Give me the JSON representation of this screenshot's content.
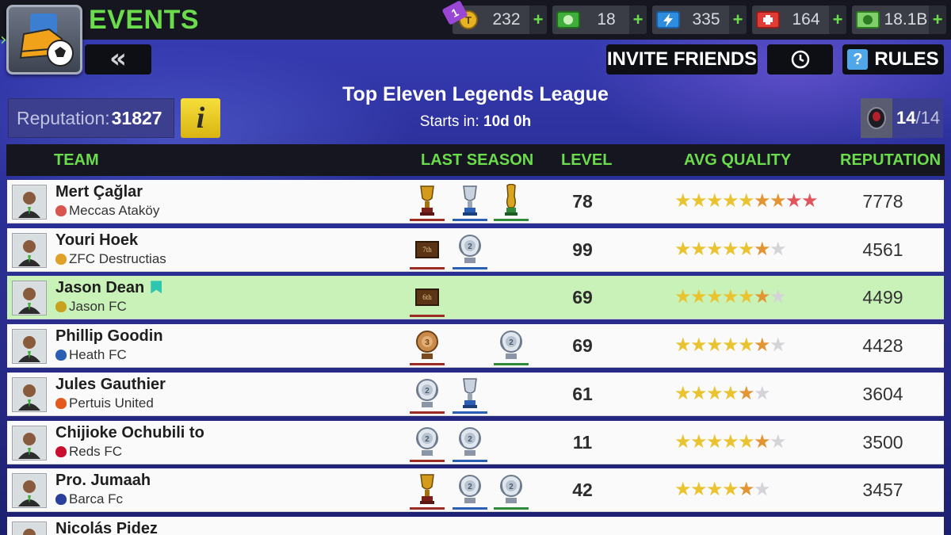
{
  "header": {
    "title": "EVENTS",
    "back_label": "«",
    "invite_label": "INVITE FRIENDS",
    "rules_label": "RULES",
    "rules_icon_glyph": "?"
  },
  "currencies": [
    {
      "icon": "token-coin-icon",
      "value": "232",
      "badge": "1"
    },
    {
      "icon": "cash-money-icon",
      "value": "18"
    },
    {
      "icon": "lightning-boost-icon",
      "value": "335"
    },
    {
      "icon": "health-cross-icon",
      "value": "164"
    },
    {
      "icon": "banknote-icon",
      "value": "18.1B"
    }
  ],
  "currency_plus": "+",
  "league": {
    "title": "Top Eleven Legends League",
    "starts_label": "Starts in:",
    "starts_value": "10d 0h",
    "reputation_label": "Reputation:",
    "reputation_value": "31827",
    "info_glyph": "i",
    "participants_current": "14",
    "participants_total": "/14"
  },
  "table": {
    "columns": [
      "TEAM",
      "LAST SEASON",
      "LEVEL",
      "AVG QUALITY",
      "REPUTATION"
    ],
    "rows": [
      {
        "manager": "Mert Çağlar",
        "team": "Meccas Ataköy",
        "level": "78",
        "reputation": "7778",
        "stars_gold": 5,
        "stars_orange": 2,
        "stars_red": 2,
        "stars_empty": 0,
        "is_me": false,
        "trophies": [
          "gold-cup",
          "silver-cup",
          "world-cup"
        ]
      },
      {
        "manager": "Youri Hoek",
        "team": "ZFC Destructias",
        "level": "99",
        "reputation": "4561",
        "stars_gold": 5,
        "stars_orange": 1,
        "stars_red": 0,
        "stars_empty": 1,
        "is_me": false,
        "trophies": [
          "placard-7th",
          "silver-medal-2"
        ],
        "placard": "7th"
      },
      {
        "manager": "Jason Dean",
        "team": "Jason FC",
        "level": "69",
        "reputation": "4499",
        "stars_gold": 5,
        "stars_orange": 1,
        "stars_red": 0,
        "stars_empty": 1,
        "is_me": true,
        "trophies": [
          "placard-6th"
        ],
        "placard": "6th"
      },
      {
        "manager": "Phillip Goodin",
        "team": "Heath FC",
        "level": "69",
        "reputation": "4428",
        "stars_gold": 5,
        "stars_orange": 1,
        "stars_red": 0,
        "stars_empty": 1,
        "is_me": false,
        "trophies": [
          "bronze-medal-3",
          "silver-medal-2"
        ]
      },
      {
        "manager": "Jules Gauthier",
        "team": "Pertuis United",
        "level": "61",
        "reputation": "3604",
        "stars_gold": 4,
        "stars_orange": 1,
        "stars_red": 0,
        "stars_empty": 1,
        "is_me": false,
        "trophies": [
          "silver-medal-2",
          "silver-cup"
        ]
      },
      {
        "manager": "Chijioke Ochubili to",
        "team": "Reds FC",
        "level": "11",
        "reputation": "3500",
        "stars_gold": 5,
        "stars_orange": 1,
        "stars_red": 0,
        "stars_empty": 1,
        "is_me": false,
        "trophies": [
          "silver-medal-2",
          "silver-medal-2"
        ]
      },
      {
        "manager": "Pro. Jumaah",
        "team": "Barca Fc",
        "level": "42",
        "reputation": "3457",
        "stars_gold": 4,
        "stars_orange": 1,
        "stars_red": 0,
        "stars_empty": 1,
        "is_me": false,
        "trophies": [
          "gold-cup",
          "silver-medal-2",
          "silver-medal-2"
        ]
      },
      {
        "manager": "Nicolás Pidez",
        "team": "",
        "level": "",
        "reputation": "",
        "stars_gold": 0,
        "stars_orange": 0,
        "stars_red": 0,
        "stars_empty": 0,
        "is_me": false,
        "trophies": []
      }
    ]
  },
  "colors": {
    "accent_green": "#6bdc4b",
    "highlight_row": "#c8f2b8",
    "background": "#2b2f9a"
  }
}
